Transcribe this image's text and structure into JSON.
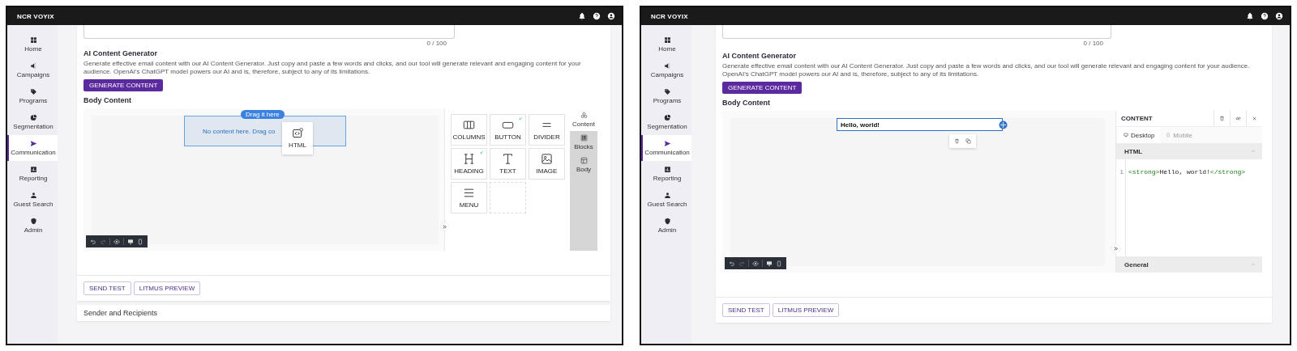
{
  "screens": [
    {
      "logo": "NCR VOYIX",
      "nav": [
        {
          "label": "Home",
          "selected": false
        },
        {
          "label": "Campaigns",
          "selected": false
        },
        {
          "label": "Programs",
          "selected": false
        },
        {
          "label": "Segmentation",
          "selected": false
        },
        {
          "label": "Communication",
          "selected": true
        },
        {
          "label": "Reporting",
          "selected": false
        },
        {
          "label": "Guest Search",
          "selected": false
        },
        {
          "label": "Admin",
          "selected": false
        }
      ],
      "counter": "0 / 100",
      "ai_title": "AI Content Generator",
      "ai_description": "Generate effective email content with our AI Content Generator. Just copy and paste a few words and clicks, and our tool will generate relevant and engaging content for your audience. OpenAI's ChatGPT model powers our AI and is, therefore, subject to any of its limitations.",
      "generate_button": "GENERATE CONTENT",
      "body_title": "Body Content",
      "editor": {
        "kind": "blocks",
        "drop_badge": "Drag it here",
        "drop_text": "No content here. Drag co",
        "drag_tile": "HTML",
        "tiles": [
          {
            "label": "COLUMNS",
            "ai": false
          },
          {
            "label": "BUTTON",
            "ai": true
          },
          {
            "label": "DIVIDER",
            "ai": false
          },
          {
            "label": "HEADING",
            "ai": true
          },
          {
            "label": "TEXT",
            "ai": false
          },
          {
            "label": "IMAGE",
            "ai": false
          },
          {
            "label": "MENU",
            "ai": false
          }
        ],
        "side_tabs": [
          {
            "label": "Content",
            "selected": true
          },
          {
            "label": "Blocks",
            "selected": false
          },
          {
            "label": "Body",
            "selected": false
          }
        ]
      },
      "actions": [
        "SEND TEST",
        "LITMUS PREVIEW"
      ],
      "next_section": "Sender and Recipients"
    },
    {
      "logo": "NCR VOYIX",
      "nav": [
        {
          "label": "Home",
          "selected": false
        },
        {
          "label": "Campaigns",
          "selected": false
        },
        {
          "label": "Programs",
          "selected": false
        },
        {
          "label": "Segmentation",
          "selected": false
        },
        {
          "label": "Communication",
          "selected": true
        },
        {
          "label": "Reporting",
          "selected": false
        },
        {
          "label": "Guest Search",
          "selected": false
        },
        {
          "label": "Admin",
          "selected": false
        }
      ],
      "counter": "0 / 100",
      "ai_title": "AI Content Generator",
      "ai_description": "Generate effective email content with our AI Content Generator. Just copy and paste a few words and clicks, and our tool will generate relevant and engaging content for your audience. OpenAI's ChatGPT model powers our AI and is, therefore, subject to any of its limitations.",
      "generate_button": "GENERATE CONTENT",
      "body_title": "Body Content",
      "editor": {
        "kind": "properties",
        "block_text": "Hello, world!",
        "panel_title": "CONTENT",
        "device_tabs": [
          {
            "label": "Desktop",
            "selected": true
          },
          {
            "label": "Mobile",
            "selected": false
          }
        ],
        "sections": [
          {
            "title": "HTML",
            "line": "1",
            "code": [
              {
                "kind": "tag",
                "text": "<strong>"
              },
              {
                "kind": "text",
                "text": "Hello, world!"
              },
              {
                "kind": "tag",
                "text": "</strong>"
              }
            ]
          },
          {
            "title": "General"
          }
        ]
      },
      "actions": [
        "SEND TEST",
        "LITMUS PREVIEW"
      ]
    }
  ]
}
